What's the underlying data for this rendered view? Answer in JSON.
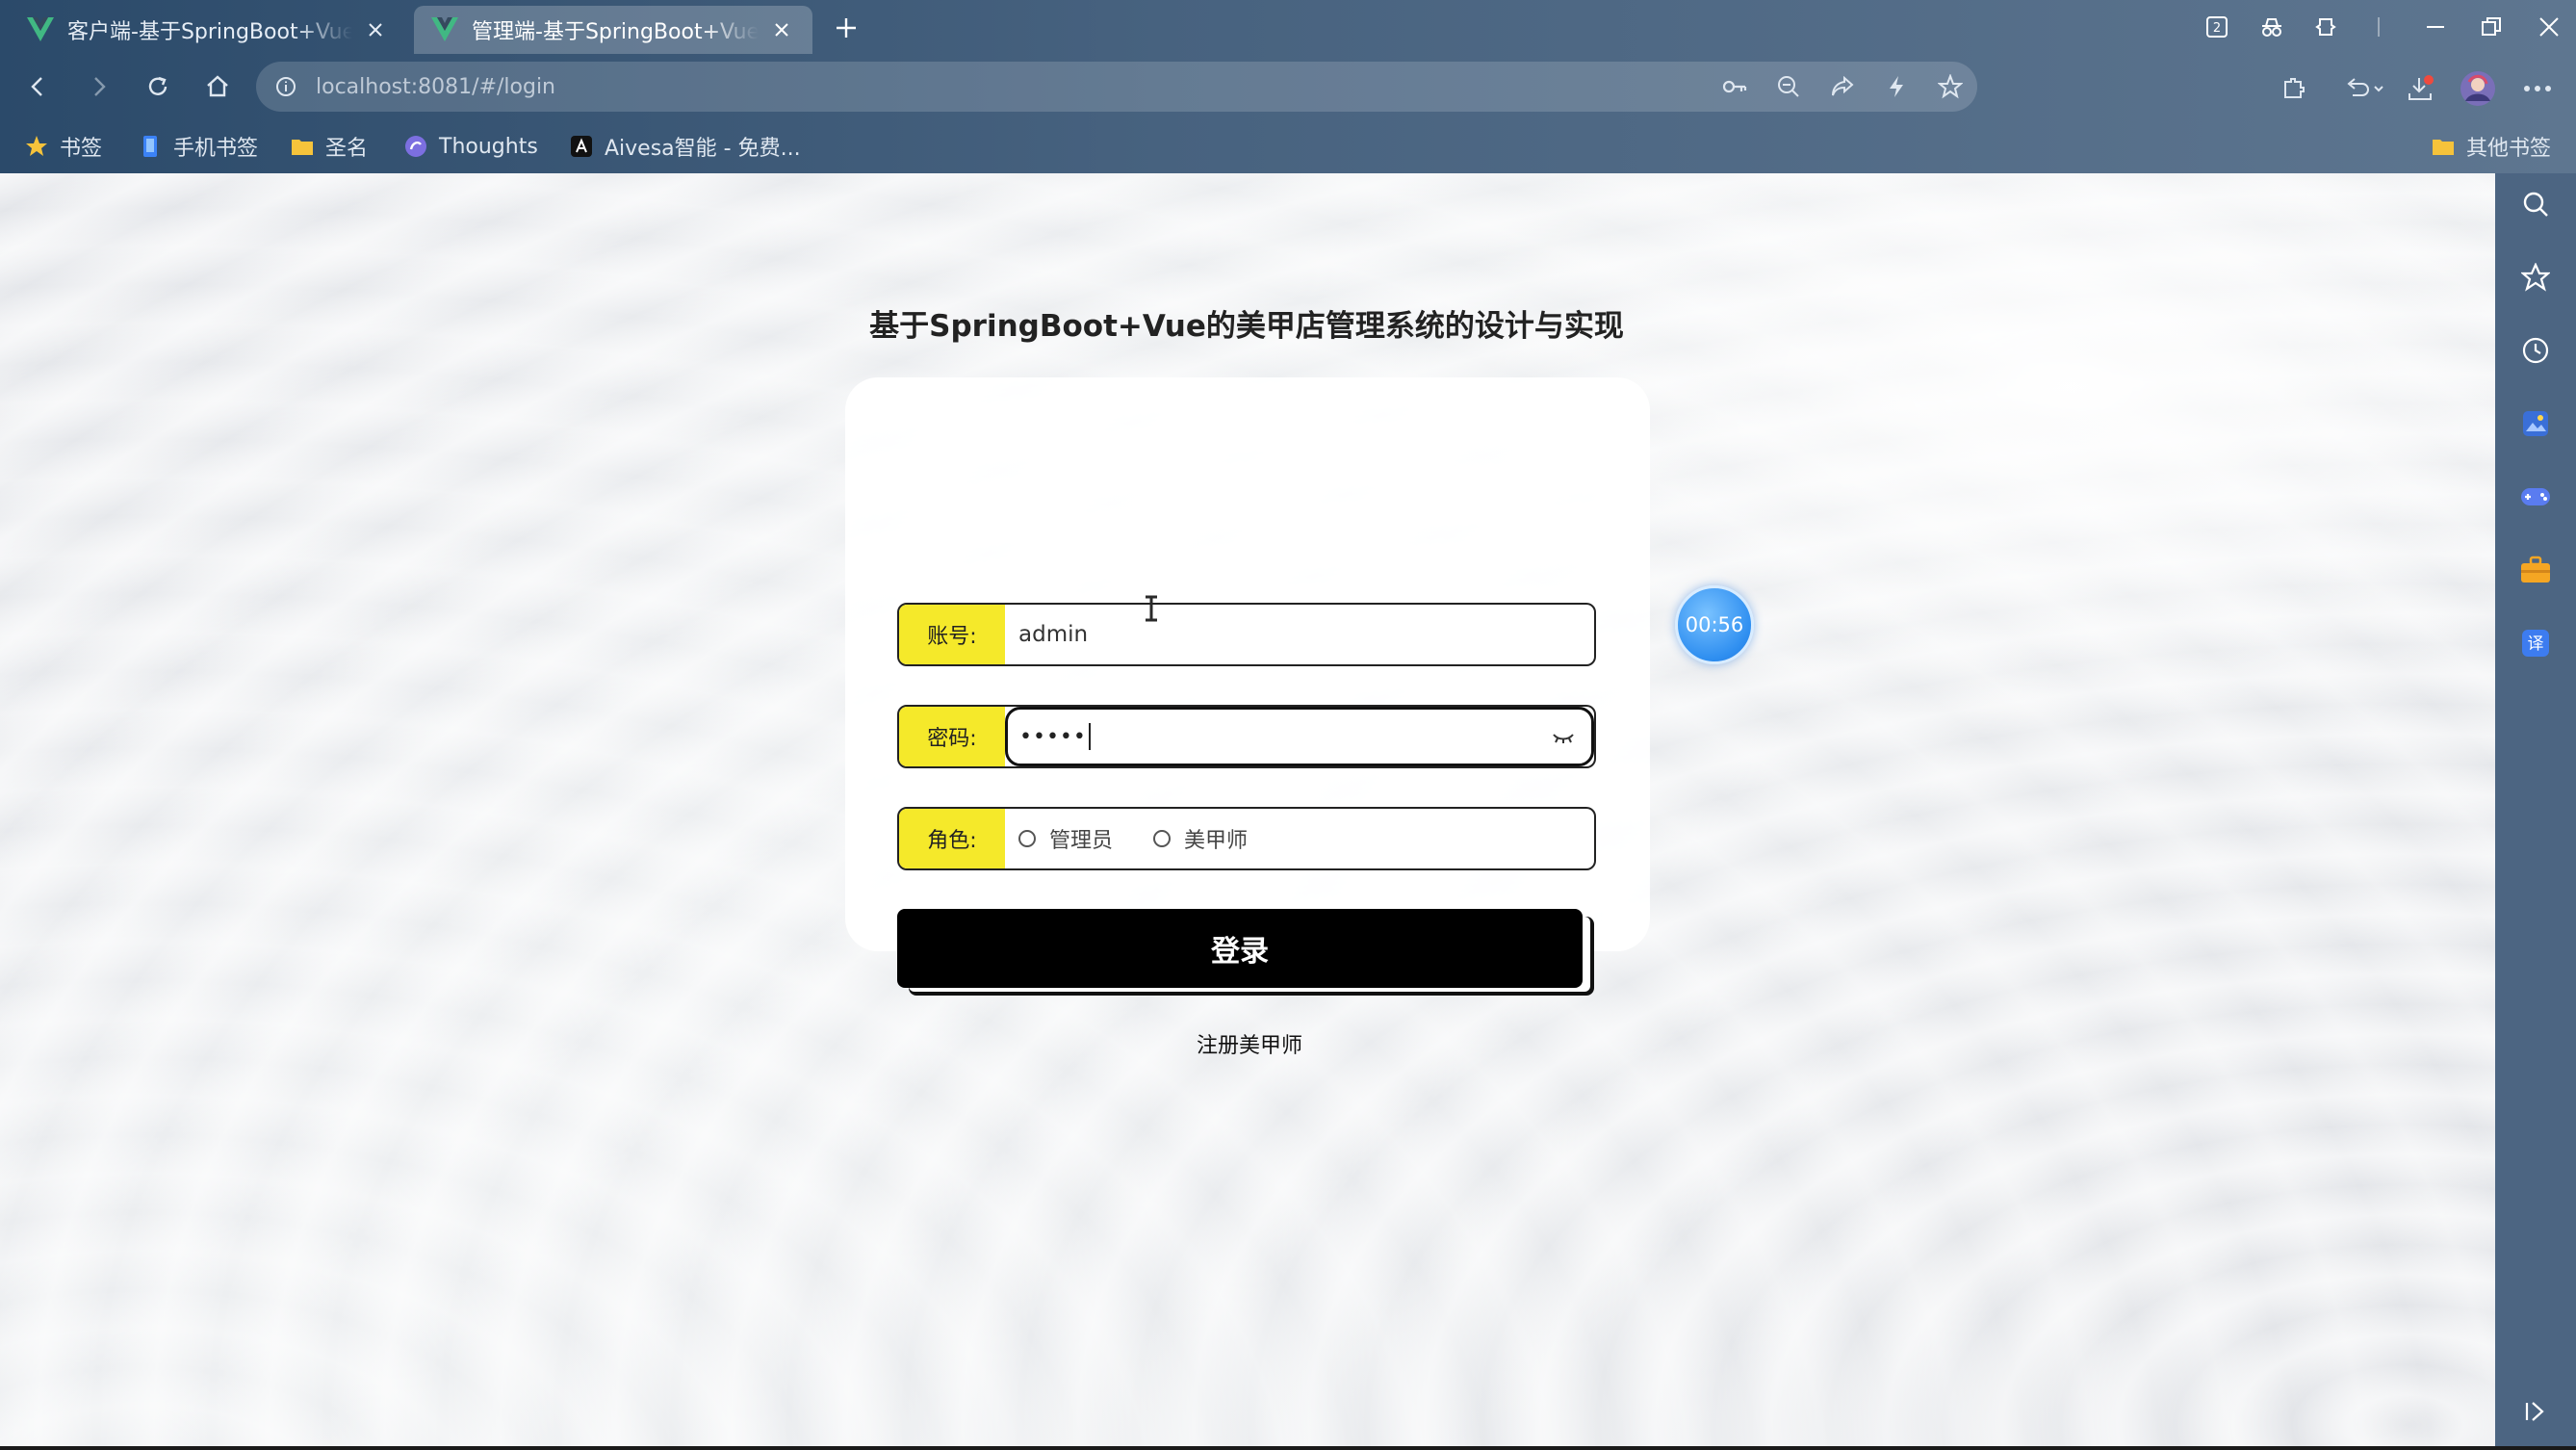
{
  "browser": {
    "tabs": [
      {
        "title": "客户端-基于SpringBoot+Vue的美甲店管理系统的设计与实现",
        "active": false
      },
      {
        "title": "管理端-基于SpringBoot+Vue的美甲店管理系统的设计与实现",
        "active": true
      }
    ],
    "url": "localhost:8081/#/login",
    "bookmarks": [
      {
        "label": "书签",
        "icon": "star-icon"
      },
      {
        "label": "手机书签",
        "icon": "phone-bookmark-icon"
      },
      {
        "label": "圣名",
        "icon": "folder-icon"
      },
      {
        "label": "Thoughts",
        "icon": "thoughts-icon"
      },
      {
        "label": "Aivesa智能 - 免费...",
        "icon": "aivesa-icon"
      }
    ],
    "other_bookmarks": "其他书签",
    "colors": {
      "chrome": "#3c5a78",
      "accent": "#f5e92a",
      "button": "#000000",
      "timer": "#2e8ef0"
    }
  },
  "login": {
    "title": "基于SpringBoot+Vue的美甲店管理系统的设计与实现",
    "account_label": "账号:",
    "account_value": "admin",
    "password_label": "密码:",
    "password_value": "•••••",
    "role_label": "角色:",
    "roles": [
      "管理员",
      "美甲师"
    ],
    "login_button": "登录",
    "register_link": "注册美甲师"
  },
  "timer": {
    "value": "00:56"
  }
}
